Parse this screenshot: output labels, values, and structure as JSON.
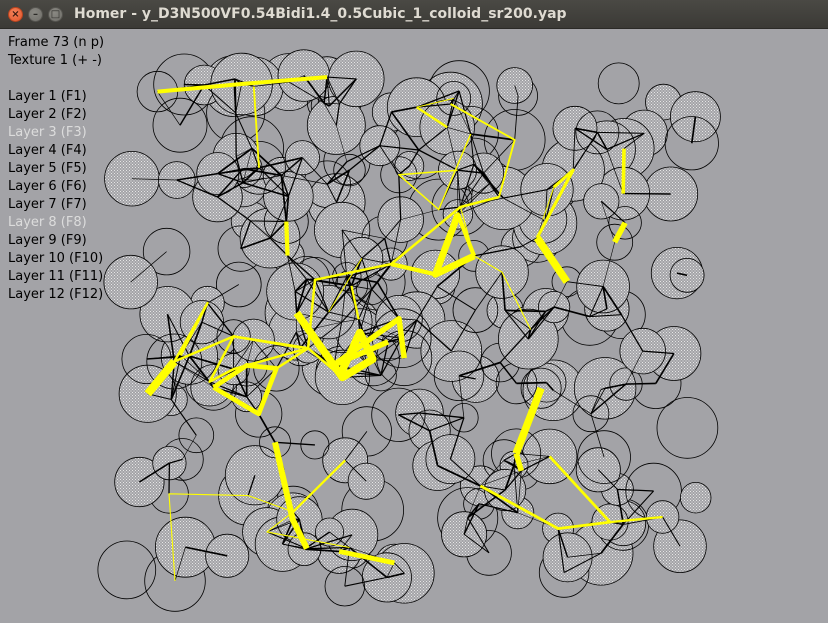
{
  "window": {
    "title": "Homer - y_D3N500VF0.54Bidi1.4_0.5Cubic_1_colloid_sr200.yap",
    "close_glyph": "×",
    "minimize_glyph": "–",
    "maximize_glyph": "□"
  },
  "overlay": {
    "frame": "Frame 73 (n p)",
    "texture": "Texture 1 (+ -)",
    "layers": [
      {
        "label": "Layer 1 (F1)",
        "active": true
      },
      {
        "label": "Layer 2 (F2)",
        "active": true
      },
      {
        "label": "Layer 3 (F3)",
        "active": false
      },
      {
        "label": "Layer 4 (F4)",
        "active": true
      },
      {
        "label": "Layer 5 (F5)",
        "active": true
      },
      {
        "label": "Layer 6 (F6)",
        "active": true
      },
      {
        "label": "Layer 7 (F7)",
        "active": true
      },
      {
        "label": "Layer 8 (F8)",
        "active": false
      },
      {
        "label": "Layer 9 (F9)",
        "active": true
      },
      {
        "label": "Layer 10 (F10)",
        "active": true
      },
      {
        "label": "Layer 11 (F11)",
        "active": true
      },
      {
        "label": "Layer 12 (F12)",
        "active": true
      }
    ]
  },
  "colors": {
    "background": "#a3a3a7",
    "particle_outline": "#000000",
    "particle_fill": "#b4b4b4",
    "force_chain": "#ffff00",
    "contact_network": "#000000",
    "layer_inactive": "#dcdcdc",
    "titlebar": "#3c3b37",
    "title_text": "#dfdbd2"
  }
}
